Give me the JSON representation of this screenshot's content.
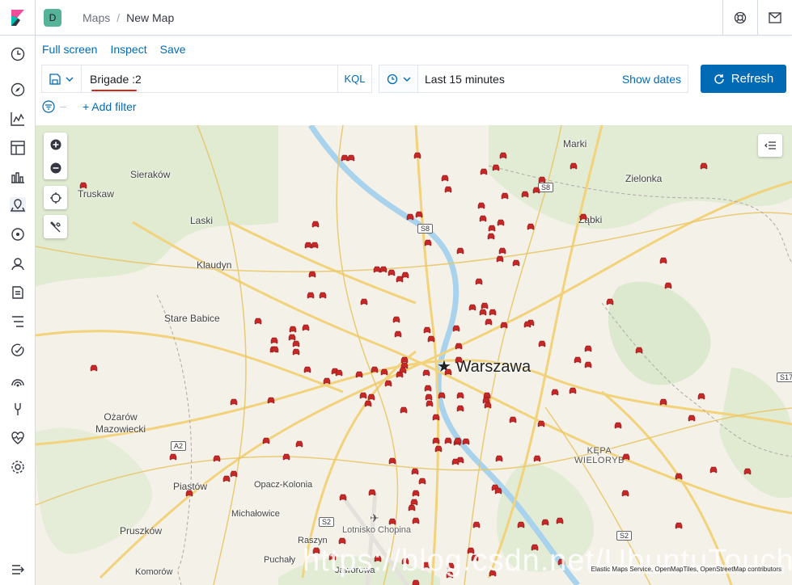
{
  "header": {
    "space_initial": "D",
    "breadcrumbs": [
      "Maps",
      "New Map"
    ],
    "separator": "/"
  },
  "top_menu": {
    "full_screen": "Full screen",
    "inspect": "Inspect",
    "save": "Save"
  },
  "query": {
    "value": "Brigade :2",
    "language": "KQL"
  },
  "time": {
    "range": "Last 15 minutes",
    "show_dates": "Show dates",
    "refresh": "Refresh"
  },
  "filter": {
    "add_label": "+ Add filter"
  },
  "map": {
    "places": {
      "marki": "Marki",
      "zielonka": "Zielonka",
      "sierakow": "Sieraków",
      "truskaw": "Truskaw",
      "laski": "Laski",
      "zabki": "Ząbki",
      "klaudyn": "Klaudyn",
      "stare_babice": "Stare Babice",
      "warszawa": "Warszawa",
      "ozarow": "Ożarów\nMazowiecki",
      "kepa": "KĘPA\nWIELORYB",
      "piastow": "Piastów",
      "opacz": "Opacz-Kolonia",
      "michalowice": "Michałowice",
      "pruszkow": "Pruszków",
      "raszyn": "Raszyn",
      "puchaly": "Puchały",
      "komorow": "Komorów",
      "jaworowa": "Jaworowa",
      "lotnisko": "Lotnisko Chopina"
    },
    "roads": {
      "s8a": "S8",
      "s8b": "S8",
      "a2": "A2",
      "s2a": "S2",
      "s2b": "S2",
      "s17": "S17"
    },
    "attribution": "Elastic Maps Service, OpenMapTiles, OpenStreetMap contributors",
    "watermark": "https://blog.csdn.net/UbuntuTouch"
  },
  "colors": {
    "accent": "#006bb4",
    "marker": "#c62828",
    "space_badge": "#54b399"
  }
}
